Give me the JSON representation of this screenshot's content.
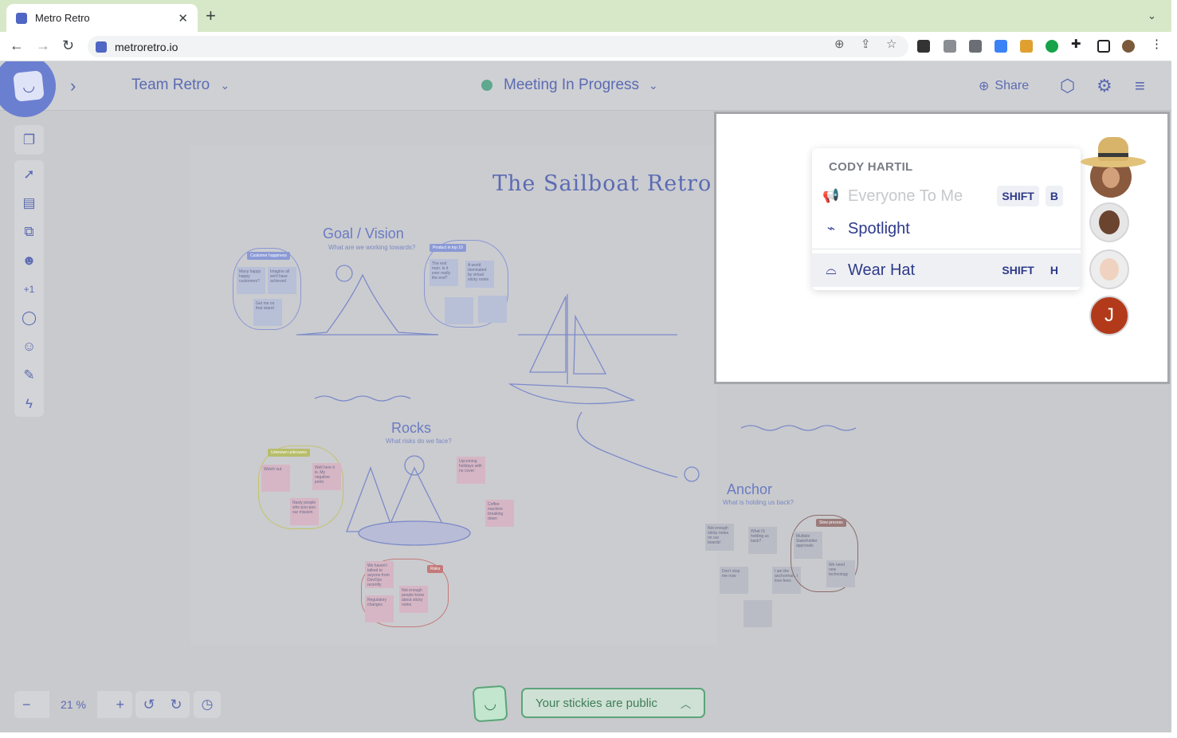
{
  "browser": {
    "tab_title": "Metro Retro",
    "url": "metroretro.io"
  },
  "app": {
    "board_name": "Team Retro",
    "status": "Meeting In Progress",
    "share_label": "Share",
    "colors": {
      "accent": "#5b6bb3",
      "status_dot": "#5fa890",
      "public_green": "#3e7f59"
    }
  },
  "canvas": {
    "title": "The Sailboat Retro",
    "sections": [
      {
        "title": "Goal / Vision",
        "subtitle": "What are we working towards?"
      },
      {
        "title": "Rocks",
        "subtitle": "What risks do we face?"
      },
      {
        "title": "Anchor",
        "subtitle": "What is holding us back?"
      }
    ],
    "chips": [
      "Customer happiness",
      "Product in top 10",
      "Unknown unknowns",
      "Risks",
      "Slow process"
    ],
    "stickies": [
      "Many happy happy customers?",
      "Imagine all we'll have achieved",
      "Get me on that island",
      "The end man. Is it ever really the end?",
      "A world dominated by virtual sticky notes",
      "Watch out",
      "Well here it is. My negative point.",
      "Nasty people who poo-poo our mission",
      "Upcoming holidays with no cover",
      "Coffee machine breaking down",
      "We haven't talked to anyone from DevOps recently",
      "Regulatory changes",
      "Not enough people know about sticky notes",
      "Not enough sticky notes on our boards!",
      "What IS holding us back?",
      "Don't stop me now",
      "I am the anchorman. I love beer.",
      "Multiple Stakeholder approvals",
      "We need new technology"
    ]
  },
  "zoom": {
    "value": "21 %"
  },
  "footer": {
    "public_label": "Your stickies are public"
  },
  "menu": {
    "user_name": "CODY HARTIL",
    "items": [
      {
        "label": "Everyone To Me",
        "shortcut_mod": "SHIFT",
        "shortcut_key": "B",
        "icon": "megaphone-icon",
        "disabled": true
      },
      {
        "label": "Spotlight",
        "icon": "spotlight-icon"
      },
      {
        "label": "Wear Hat",
        "shortcut_mod": "SHIFT",
        "shortcut_key": "H",
        "icon": "hat-icon",
        "selected": true
      }
    ]
  },
  "participants": [
    {
      "kind": "photo",
      "name": "avatar-woman-hat"
    },
    {
      "kind": "photo",
      "name": "avatar-man"
    },
    {
      "kind": "photo",
      "name": "avatar-person"
    },
    {
      "kind": "initial",
      "initial": "J",
      "color": "#b23a1a"
    }
  ]
}
